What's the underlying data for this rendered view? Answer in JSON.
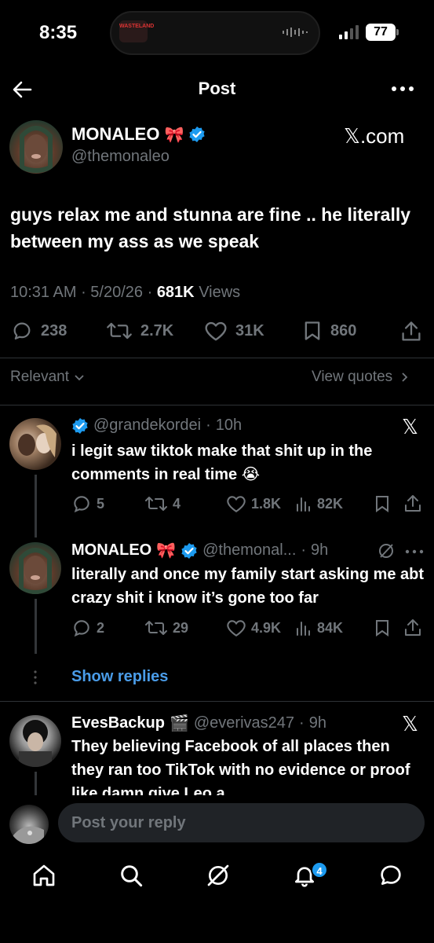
{
  "status_bar": {
    "time": "8:35",
    "island_art_text": "WASTELAND",
    "battery": "77"
  },
  "nav": {
    "title": "Post",
    "back_icon": "arrow-left-icon",
    "more_icon": "more-horizontal-icon"
  },
  "post": {
    "author_name": "MONALEO",
    "author_emoji": "🎀",
    "handle": "@themonaleo",
    "source": "𝕏.com",
    "text": "guys relax me and stunna are fine .. he literally between my ass as we speak",
    "time": "10:31 AM",
    "date": "5/20/26",
    "views_count": "681K",
    "views_label": "Views",
    "replies": "238",
    "reposts": "2.7K",
    "likes": "31K",
    "bookmarks": "860"
  },
  "sort": {
    "label": "Relevant",
    "view_quotes": "View quotes"
  },
  "replies": [
    {
      "handle": "@grandekordei",
      "sep": "·",
      "age": "10h",
      "text": "i legit saw tiktok make that shit up in the comments in real time 😭",
      "replies": "5",
      "reposts": "4",
      "likes": "1.8K",
      "views": "82K"
    },
    {
      "name": "MONALEO",
      "emoji": "🎀",
      "handle": "@themonal...",
      "sep": "·",
      "age": "9h",
      "text": "literally and once my family start asking me abt crazy shit i know it’s gone too far",
      "replies": "2",
      "reposts": "29",
      "likes": "4.9K",
      "views": "84K"
    },
    {
      "name": "EvesBackup",
      "emoji": "🎬",
      "handle": "@everivas247",
      "sep": "·",
      "age": "9h",
      "text": "They believing Facebook of all places then they ran too TikTok with no evidence or proof like damn give Leo a"
    }
  ],
  "show_replies": "Show replies",
  "composer": {
    "placeholder": "Post your reply"
  },
  "tabs": {
    "notifications_badge": "4"
  },
  "colors": {
    "background": "#000000",
    "text_primary": "#e7e9ea",
    "text_secondary": "#71767b",
    "accent_blue": "#1d9bf0",
    "link_blue": "#4a9ce8"
  }
}
